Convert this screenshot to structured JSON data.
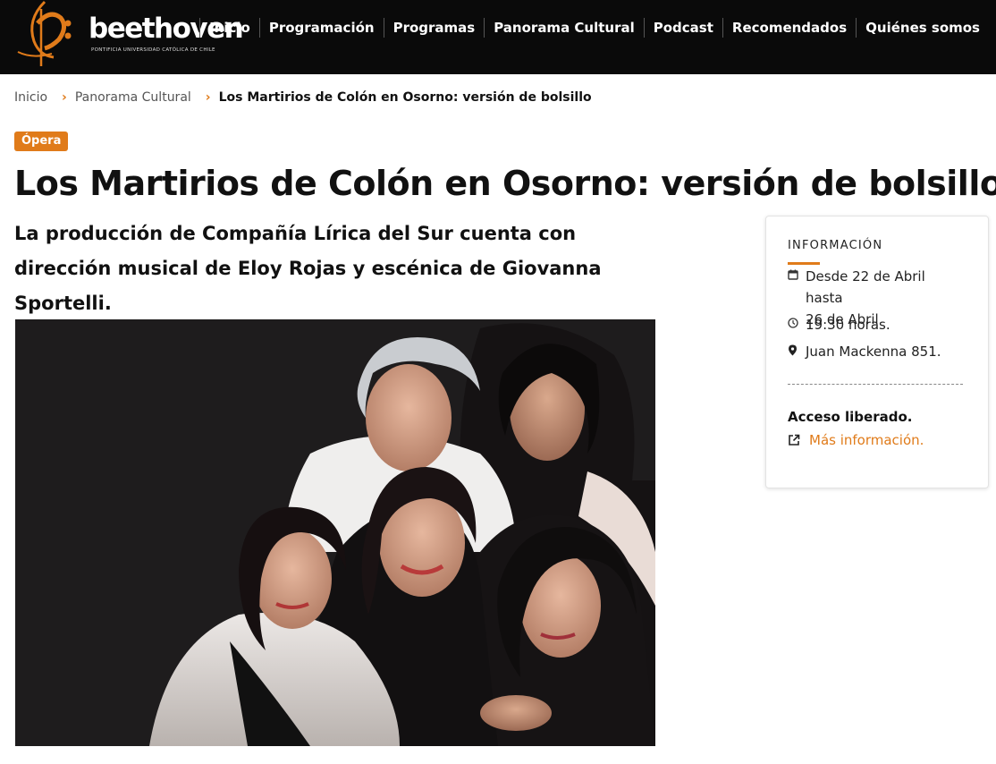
{
  "brand": {
    "name": "beethoven",
    "subtitle": "PONTIFICIA UNIVERSIDAD CATÓLICA DE CHILE",
    "accent": "#e07b1a"
  },
  "nav": {
    "items": [
      {
        "label": "Inicio"
      },
      {
        "label": "Programación"
      },
      {
        "label": "Programas"
      },
      {
        "label": "Panorama Cultural"
      },
      {
        "label": "Podcast"
      },
      {
        "label": "Recomendados"
      },
      {
        "label": "Quiénes somos"
      }
    ]
  },
  "breadcrumb": {
    "home": "Inicio",
    "section": "Panorama Cultural",
    "current": "Los Martirios de Colón en Osorno: versión de bolsillo"
  },
  "article": {
    "category": "Ópera",
    "title": "Los Martirios de Colón en Osorno: versión de bolsillo",
    "lead": "La producción de Compañía Lírica del Sur cuenta con dirección musical de Eloy Rojas y escénica de Giovanna Sportelli."
  },
  "info": {
    "heading": "INFORMACIÓN",
    "date_line1": "Desde 22 de Abril hasta",
    "date_line2": "26 de Abril",
    "time": "19:30 horas.",
    "location": "Juan Mackenna 851.",
    "access": "Acceso liberado.",
    "more_link": "Más información.",
    "icons": [
      "calendar-icon",
      "clock-icon",
      "location-pin-icon",
      "external-link-icon"
    ]
  }
}
